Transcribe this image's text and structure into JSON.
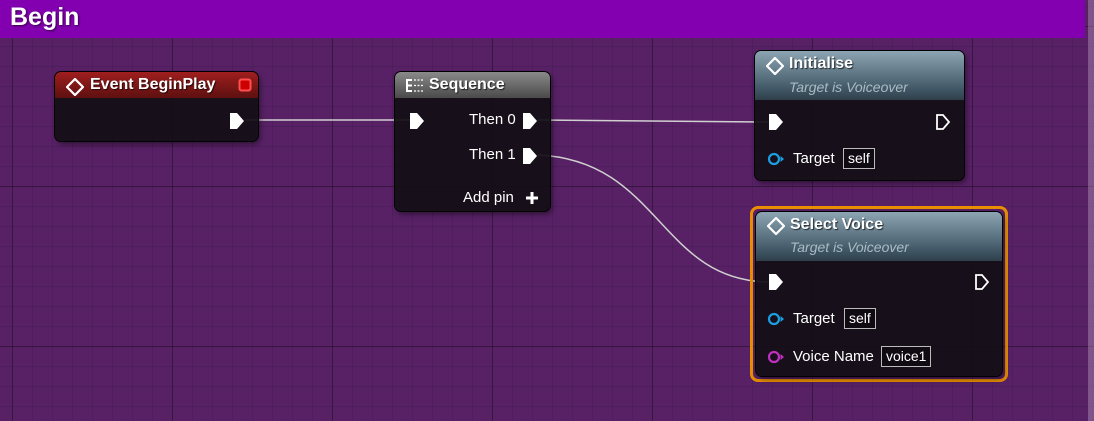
{
  "graph": {
    "section_title": "Begin"
  },
  "nodes": {
    "event_begin_play": {
      "title": "Event BeginPlay"
    },
    "sequence": {
      "title": "Sequence",
      "then0": "Then 0",
      "then1": "Then 1",
      "add_pin": "Add pin"
    },
    "initialise": {
      "title": "Initialise",
      "subtitle": "Target is Voiceover",
      "target_label": "Target",
      "target_value": "self"
    },
    "select_voice": {
      "title": "Select Voice",
      "subtitle": "Target is Voiceover",
      "target_label": "Target",
      "target_value": "self",
      "voice_label": "Voice Name",
      "voice_value": "voice1"
    }
  },
  "colors": {
    "event_header": "#a01e1e",
    "function_header": "#3f5563",
    "selection": "#e88e00",
    "object_pin": "#1aa0e0",
    "name_pin": "#c030c0",
    "wire": "#d8d8d8"
  },
  "icons": [
    "event-diamond-icon",
    "sequence-icon",
    "function-diamond-icon",
    "exec-pin-icon",
    "object-pin-icon",
    "name-pin-icon",
    "add-pin-icon",
    "delegate-pin-icon"
  ]
}
